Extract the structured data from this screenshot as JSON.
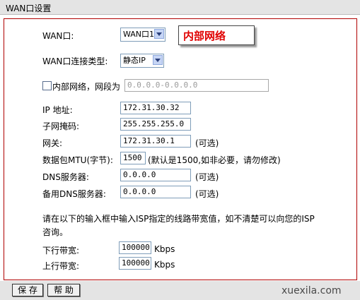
{
  "window": {
    "title": "WAN口设置"
  },
  "annotation": {
    "text": "内部网络",
    "color": "#e00000"
  },
  "form": {
    "wan_port": {
      "label": "WAN口:",
      "value": "WAN口1"
    },
    "connection_type": {
      "label": "WAN口连接类型:",
      "value": "静态IP"
    },
    "internal_network": {
      "label": "内部网络，网段为",
      "checked": false,
      "placeholder": "0.0.0.0-0.0.0.0"
    },
    "ip": {
      "label": "IP 地址:",
      "value": "172.31.30.32"
    },
    "subnet": {
      "label": "子网掩码:",
      "value": "255.255.255.0"
    },
    "gateway": {
      "label": "网关:",
      "value": "172.31.30.1",
      "note": "(可选)"
    },
    "mtu": {
      "label": "数据包MTU(字节):",
      "value": "1500",
      "note": "(默认是1500,如非必要，请勿修改)"
    },
    "dns": {
      "label": "DNS服务器:",
      "value": "0.0.0.0",
      "note": "(可选)"
    },
    "dns_backup": {
      "label": "备用DNS服务器:",
      "value": "0.0.0.0",
      "note": "(可选)"
    },
    "bandwidth_hint_line1": "请在以下的输入框中输入ISP指定的线路带宽值，如不清楚可以向您的ISP",
    "bandwidth_hint_line2": "咨询。",
    "downlink": {
      "label": "下行带宽:",
      "value": "100000",
      "unit": "Kbps"
    },
    "uplink": {
      "label": "上行带宽:",
      "value": "100000",
      "unit": "Kbps"
    }
  },
  "buttons": {
    "save": "保 存",
    "help": "帮 助"
  },
  "watermark": "xuexila.com",
  "colors": {
    "panel_border": "#b00000",
    "bar_bg": "#e4e4e4",
    "field_border": "#7f9db9"
  }
}
